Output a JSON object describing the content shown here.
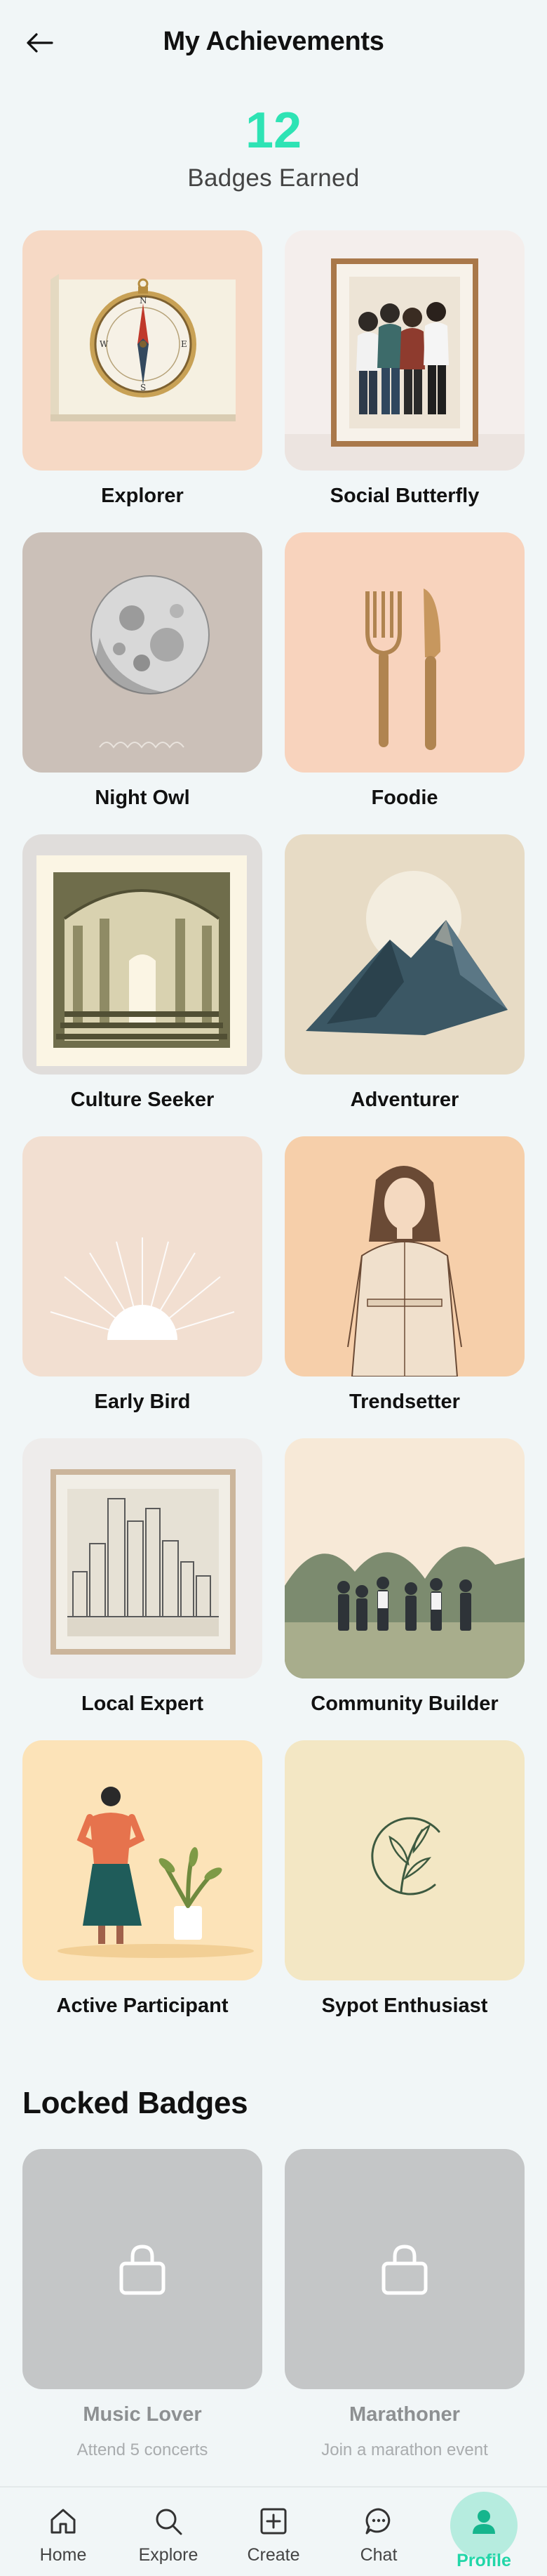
{
  "header": {
    "title": "My Achievements"
  },
  "summary": {
    "count": "12",
    "label": "Badges Earned"
  },
  "badges": [
    {
      "name": "Explorer"
    },
    {
      "name": "Social Butterfly"
    },
    {
      "name": "Night Owl"
    },
    {
      "name": "Foodie"
    },
    {
      "name": "Culture Seeker"
    },
    {
      "name": "Adventurer"
    },
    {
      "name": "Early Bird"
    },
    {
      "name": "Trendsetter"
    },
    {
      "name": "Local Expert"
    },
    {
      "name": "Community Builder"
    },
    {
      "name": "Active Participant"
    },
    {
      "name": "Sypot Enthusiast"
    }
  ],
  "locked": {
    "title": "Locked Badges",
    "items": [
      {
        "name": "Music Lover",
        "description": "Attend 5 concerts"
      },
      {
        "name": "Marathoner",
        "description": "Join a marathon event"
      }
    ]
  },
  "nav": {
    "items": [
      {
        "label": "Home",
        "icon": "home-icon"
      },
      {
        "label": "Explore",
        "icon": "search-icon"
      },
      {
        "label": "Create",
        "icon": "plus-square-icon"
      },
      {
        "label": "Chat",
        "icon": "chat-icon"
      },
      {
        "label": "Profile",
        "icon": "user-icon"
      }
    ],
    "active": "Profile"
  },
  "colors": {
    "accent": "#2ee3b4",
    "background": "#f1f6f7",
    "locked_tile": "#c4c6c7"
  }
}
